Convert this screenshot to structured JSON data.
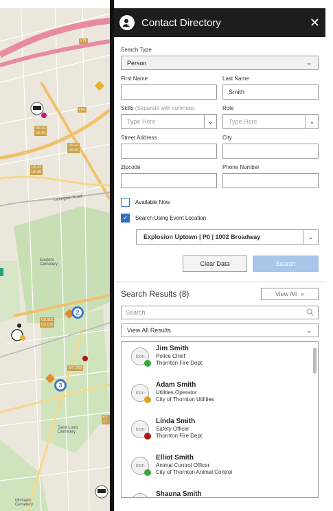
{
  "panel": {
    "title": "Contact Directory",
    "close_icon": "close-icon"
  },
  "form": {
    "search_type_label": "Search Type",
    "search_type_value": "Person",
    "first_name_label": "First Name",
    "first_name_value": "",
    "last_name_label": "Last Name",
    "last_name_value": "Smith",
    "skills_label": "Skills",
    "skills_hint": "(Separate with commas)",
    "skills_placeholder": "Type Here",
    "role_label": "Role",
    "role_placeholder": "Type Here",
    "street_label": "Street Address",
    "city_label": "City",
    "zipcode_label": "Zipcode",
    "phone_label": "Phone Number",
    "available_now_label": "Available Now",
    "available_now_checked": false,
    "event_location_label": "Search Using Event Location",
    "event_location_checked": true,
    "event_value": "Explosion Uptown | P0 | 1002 Broadway",
    "clear_label": "Clear Data",
    "search_label": "Search"
  },
  "results": {
    "title": "Search Results (8)",
    "view_all_label": "View All",
    "search_placeholder": "Search",
    "filter_value": "View All Results",
    "icon_text": "Icon",
    "items": [
      {
        "name": "Jim Smith",
        "role": "Police Chief",
        "org": "Thornton Fire Dept.",
        "status_color": "#3aa83a"
      },
      {
        "name": "Adam Smith",
        "role": "Utilities Operator",
        "org": "City of Thornton Utilities",
        "status_color": "#e2a21b"
      },
      {
        "name": "Linda Smith",
        "role": "Safety Officer",
        "org": "Thornton Fire Dept.",
        "status_color": "#b31414"
      },
      {
        "name": "Elliot Smith",
        "role": "Animal Control Officer",
        "org": "City of Thornton Animal Control",
        "status_color": "#3aa83a"
      },
      {
        "name": "Shauna Smith",
        "role": "",
        "org": "",
        "status_color": "#3aa83a"
      }
    ]
  },
  "map": {
    "labels": [
      "Lexington Road",
      "Eastern Cemetery",
      "Saint Louis Cemetery",
      "Michaels Cemetery"
    ],
    "shields": [
      "US 42",
      "US 60",
      "I-64",
      "I-71",
      "US 31E",
      "US 150",
      "KY 1703",
      "KY 17"
    ],
    "cluster_1": "2",
    "cluster_2": "3"
  },
  "colors": {
    "header_bg": "#1d1d1d",
    "accent": "#2c6fc7",
    "search_button": "#a9c6ea",
    "map_bg": "#e9e4d8",
    "cluster": "#3b78c9"
  }
}
